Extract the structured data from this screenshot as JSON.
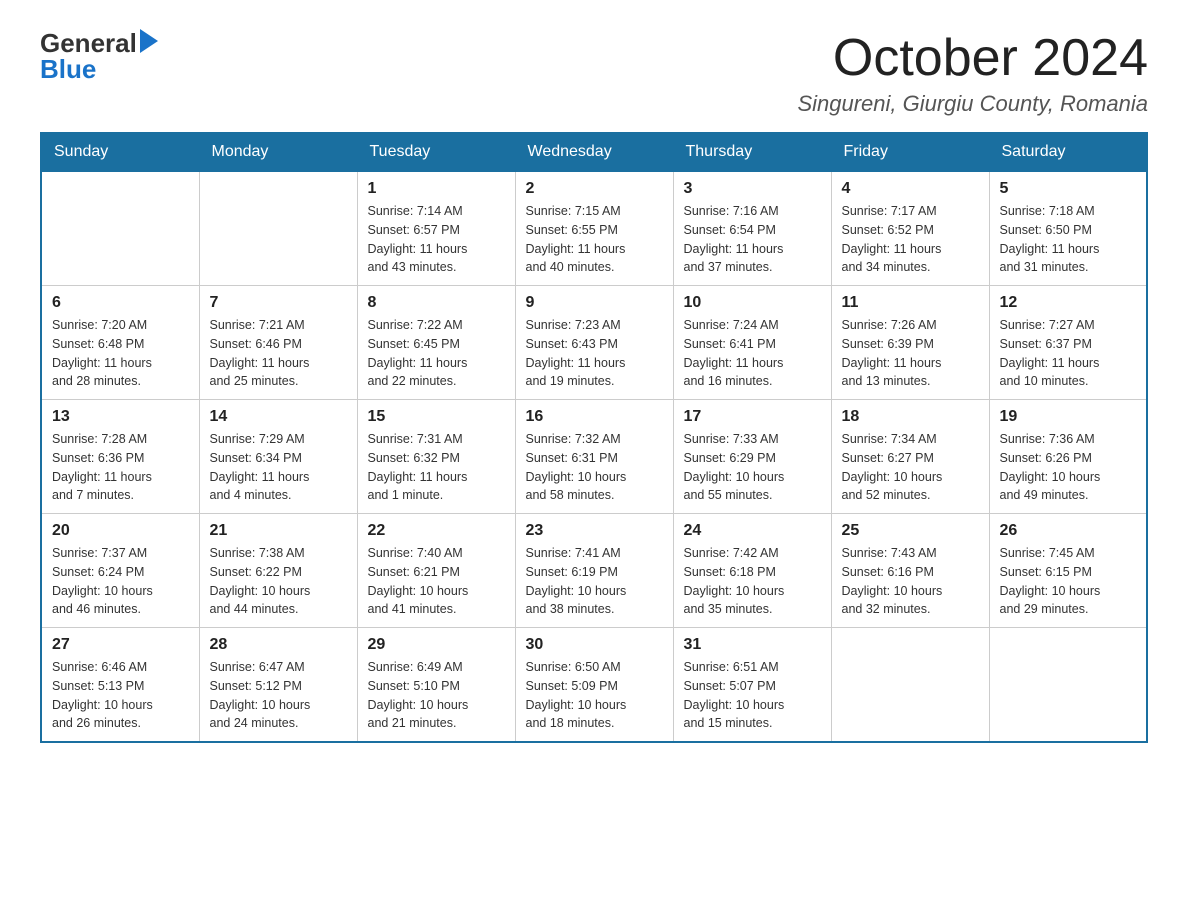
{
  "header": {
    "logo_general": "General",
    "logo_blue": "Blue",
    "month_title": "October 2024",
    "location": "Singureni, Giurgiu County, Romania"
  },
  "days_of_week": [
    "Sunday",
    "Monday",
    "Tuesday",
    "Wednesday",
    "Thursday",
    "Friday",
    "Saturday"
  ],
  "weeks": [
    [
      {
        "day": "",
        "info": ""
      },
      {
        "day": "",
        "info": ""
      },
      {
        "day": "1",
        "info": "Sunrise: 7:14 AM\nSunset: 6:57 PM\nDaylight: 11 hours\nand 43 minutes."
      },
      {
        "day": "2",
        "info": "Sunrise: 7:15 AM\nSunset: 6:55 PM\nDaylight: 11 hours\nand 40 minutes."
      },
      {
        "day": "3",
        "info": "Sunrise: 7:16 AM\nSunset: 6:54 PM\nDaylight: 11 hours\nand 37 minutes."
      },
      {
        "day": "4",
        "info": "Sunrise: 7:17 AM\nSunset: 6:52 PM\nDaylight: 11 hours\nand 34 minutes."
      },
      {
        "day": "5",
        "info": "Sunrise: 7:18 AM\nSunset: 6:50 PM\nDaylight: 11 hours\nand 31 minutes."
      }
    ],
    [
      {
        "day": "6",
        "info": "Sunrise: 7:20 AM\nSunset: 6:48 PM\nDaylight: 11 hours\nand 28 minutes."
      },
      {
        "day": "7",
        "info": "Sunrise: 7:21 AM\nSunset: 6:46 PM\nDaylight: 11 hours\nand 25 minutes."
      },
      {
        "day": "8",
        "info": "Sunrise: 7:22 AM\nSunset: 6:45 PM\nDaylight: 11 hours\nand 22 minutes."
      },
      {
        "day": "9",
        "info": "Sunrise: 7:23 AM\nSunset: 6:43 PM\nDaylight: 11 hours\nand 19 minutes."
      },
      {
        "day": "10",
        "info": "Sunrise: 7:24 AM\nSunset: 6:41 PM\nDaylight: 11 hours\nand 16 minutes."
      },
      {
        "day": "11",
        "info": "Sunrise: 7:26 AM\nSunset: 6:39 PM\nDaylight: 11 hours\nand 13 minutes."
      },
      {
        "day": "12",
        "info": "Sunrise: 7:27 AM\nSunset: 6:37 PM\nDaylight: 11 hours\nand 10 minutes."
      }
    ],
    [
      {
        "day": "13",
        "info": "Sunrise: 7:28 AM\nSunset: 6:36 PM\nDaylight: 11 hours\nand 7 minutes."
      },
      {
        "day": "14",
        "info": "Sunrise: 7:29 AM\nSunset: 6:34 PM\nDaylight: 11 hours\nand 4 minutes."
      },
      {
        "day": "15",
        "info": "Sunrise: 7:31 AM\nSunset: 6:32 PM\nDaylight: 11 hours\nand 1 minute."
      },
      {
        "day": "16",
        "info": "Sunrise: 7:32 AM\nSunset: 6:31 PM\nDaylight: 10 hours\nand 58 minutes."
      },
      {
        "day": "17",
        "info": "Sunrise: 7:33 AM\nSunset: 6:29 PM\nDaylight: 10 hours\nand 55 minutes."
      },
      {
        "day": "18",
        "info": "Sunrise: 7:34 AM\nSunset: 6:27 PM\nDaylight: 10 hours\nand 52 minutes."
      },
      {
        "day": "19",
        "info": "Sunrise: 7:36 AM\nSunset: 6:26 PM\nDaylight: 10 hours\nand 49 minutes."
      }
    ],
    [
      {
        "day": "20",
        "info": "Sunrise: 7:37 AM\nSunset: 6:24 PM\nDaylight: 10 hours\nand 46 minutes."
      },
      {
        "day": "21",
        "info": "Sunrise: 7:38 AM\nSunset: 6:22 PM\nDaylight: 10 hours\nand 44 minutes."
      },
      {
        "day": "22",
        "info": "Sunrise: 7:40 AM\nSunset: 6:21 PM\nDaylight: 10 hours\nand 41 minutes."
      },
      {
        "day": "23",
        "info": "Sunrise: 7:41 AM\nSunset: 6:19 PM\nDaylight: 10 hours\nand 38 minutes."
      },
      {
        "day": "24",
        "info": "Sunrise: 7:42 AM\nSunset: 6:18 PM\nDaylight: 10 hours\nand 35 minutes."
      },
      {
        "day": "25",
        "info": "Sunrise: 7:43 AM\nSunset: 6:16 PM\nDaylight: 10 hours\nand 32 minutes."
      },
      {
        "day": "26",
        "info": "Sunrise: 7:45 AM\nSunset: 6:15 PM\nDaylight: 10 hours\nand 29 minutes."
      }
    ],
    [
      {
        "day": "27",
        "info": "Sunrise: 6:46 AM\nSunset: 5:13 PM\nDaylight: 10 hours\nand 26 minutes."
      },
      {
        "day": "28",
        "info": "Sunrise: 6:47 AM\nSunset: 5:12 PM\nDaylight: 10 hours\nand 24 minutes."
      },
      {
        "day": "29",
        "info": "Sunrise: 6:49 AM\nSunset: 5:10 PM\nDaylight: 10 hours\nand 21 minutes."
      },
      {
        "day": "30",
        "info": "Sunrise: 6:50 AM\nSunset: 5:09 PM\nDaylight: 10 hours\nand 18 minutes."
      },
      {
        "day": "31",
        "info": "Sunrise: 6:51 AM\nSunset: 5:07 PM\nDaylight: 10 hours\nand 15 minutes."
      },
      {
        "day": "",
        "info": ""
      },
      {
        "day": "",
        "info": ""
      }
    ]
  ]
}
